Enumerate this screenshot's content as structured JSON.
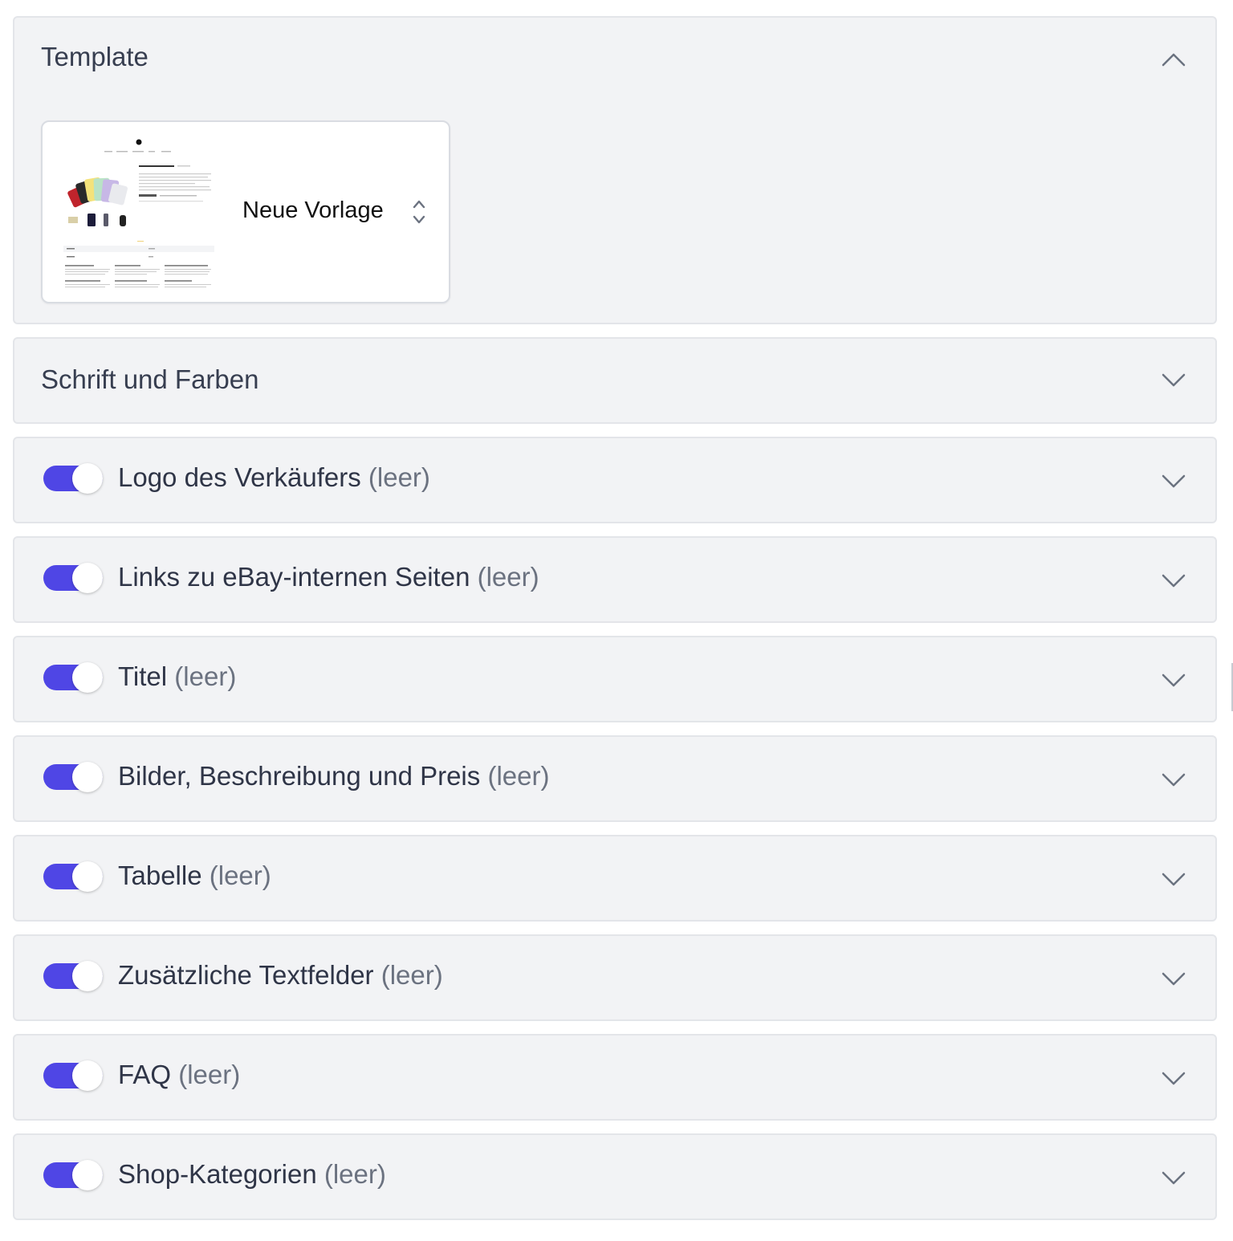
{
  "template": {
    "title": "Template",
    "selected_template": "Neue Vorlage",
    "expanded": true
  },
  "fonts_colors": {
    "title": "Schrift und Farben"
  },
  "accent_color": "#4f46e5",
  "empty_suffix": "(leer)",
  "sections": [
    {
      "label": "Logo des Verkäufers",
      "suffix": "(leer)",
      "enabled": true
    },
    {
      "label": "Links zu eBay-internen Seiten",
      "suffix": "(leer)",
      "enabled": true
    },
    {
      "label": "Titel",
      "suffix": "(leer)",
      "enabled": true
    },
    {
      "label": "Bilder, Beschreibung und Preis",
      "suffix": "(leer)",
      "enabled": true
    },
    {
      "label": "Tabelle",
      "suffix": "(leer)",
      "enabled": true
    },
    {
      "label": "Zusätzliche Textfelder",
      "suffix": "(leer)",
      "enabled": true
    },
    {
      "label": "FAQ",
      "suffix": "(leer)",
      "enabled": true
    },
    {
      "label": "Shop-Kategorien",
      "suffix": "(leer)",
      "enabled": true
    }
  ],
  "icons": {
    "collapse": "chevron-up-icon",
    "expand": "chevron-down-icon",
    "select": "updown-arrows-icon"
  }
}
